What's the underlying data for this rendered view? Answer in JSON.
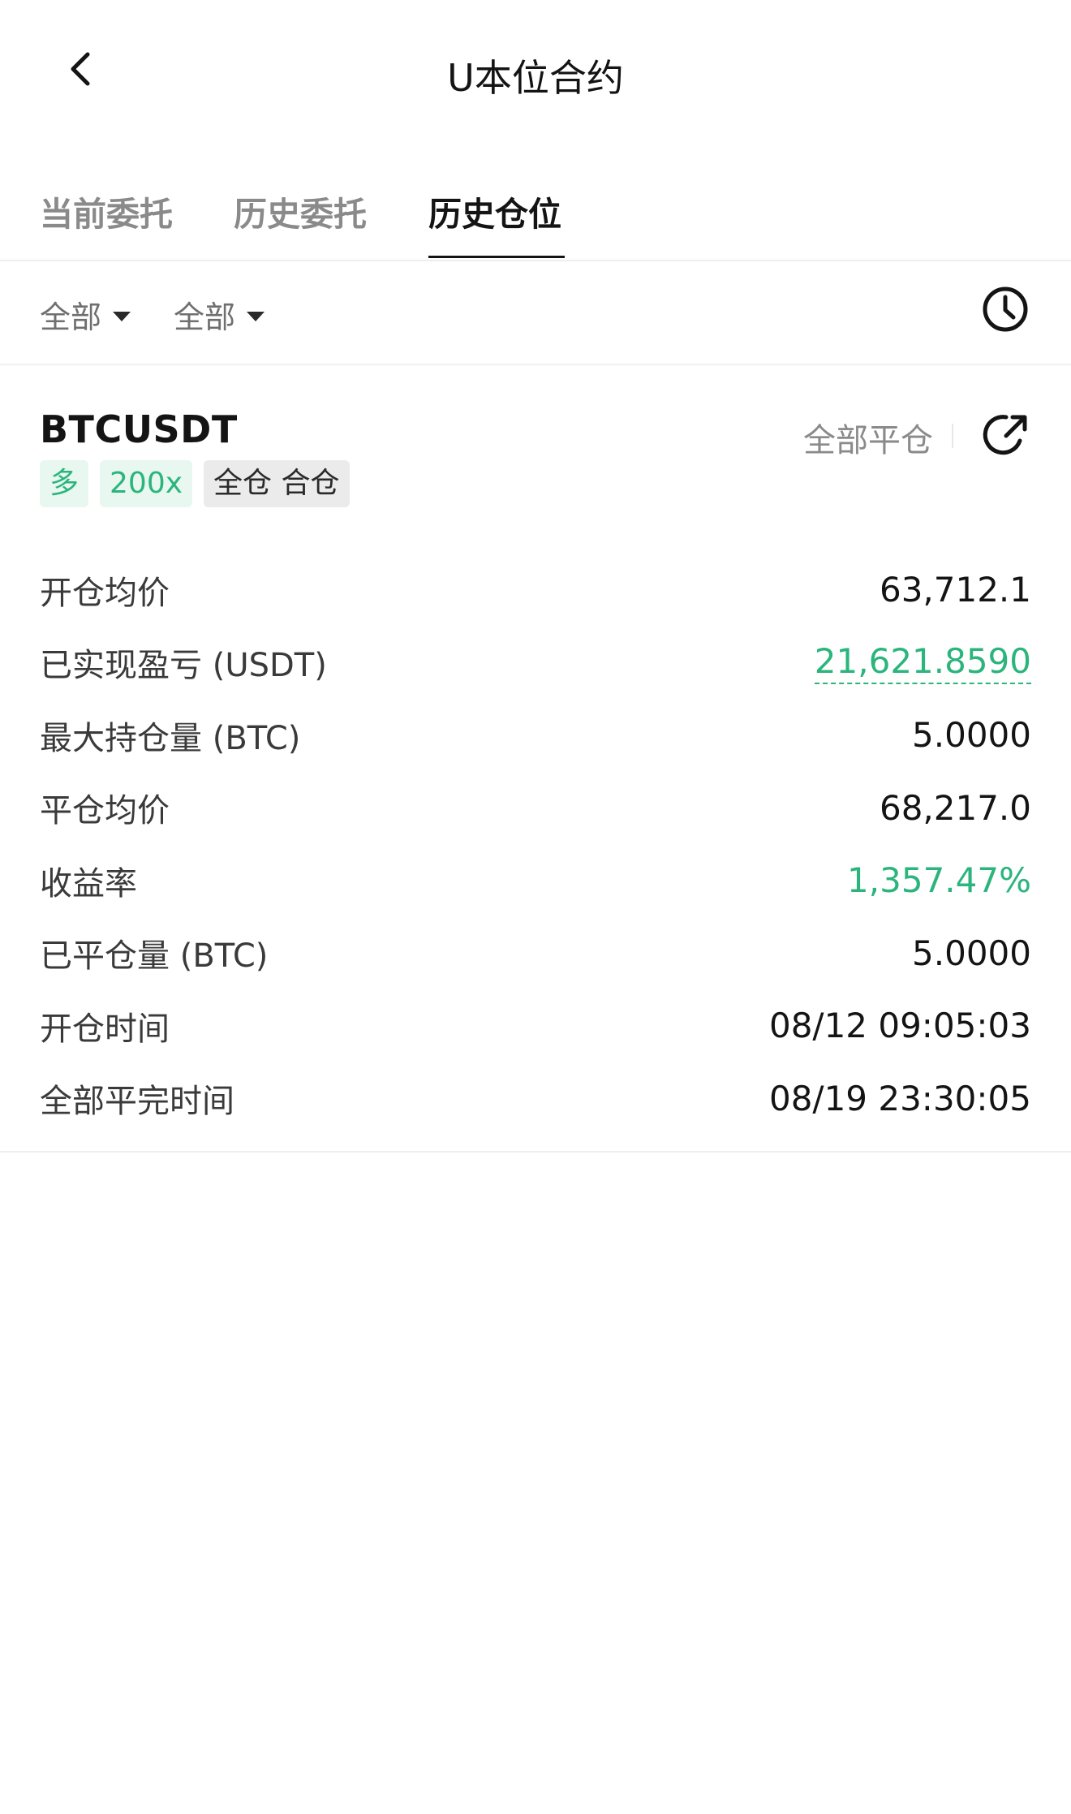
{
  "header": {
    "title": "U本位合约"
  },
  "tabs": [
    {
      "label": "当前委托",
      "active": false
    },
    {
      "label": "历史委托",
      "active": false
    },
    {
      "label": "历史仓位",
      "active": true
    }
  ],
  "filters": {
    "filter1": "全部",
    "filter2": "全部"
  },
  "position": {
    "symbol": "BTCUSDT",
    "close_all_label": "全部平仓",
    "tags": {
      "side": "多",
      "leverage": "200x",
      "margin_mode": "全仓 合仓"
    },
    "rows": [
      {
        "label": "开仓均价",
        "value": "63,712.1"
      },
      {
        "label": "已实现盈亏 (USDT)",
        "value": "21,621.8590"
      },
      {
        "label": "最大持仓量 (BTC)",
        "value": "5.0000"
      },
      {
        "label": "平仓均价",
        "value": "68,217.0"
      },
      {
        "label": "收益率",
        "value": "1,357.47%"
      },
      {
        "label": "已平仓量 (BTC)",
        "value": "5.0000"
      },
      {
        "label": "开仓时间",
        "value": "08/12 09:05:03"
      },
      {
        "label": "全部平完时间",
        "value": "08/19 23:30:05"
      }
    ]
  },
  "colors": {
    "profit_green": "#2bb57c",
    "text_primary": "#141414",
    "text_secondary": "#8a8a8a"
  },
  "icons": {
    "back": "chevron-left-icon",
    "history": "clock-icon",
    "share": "share-icon"
  }
}
